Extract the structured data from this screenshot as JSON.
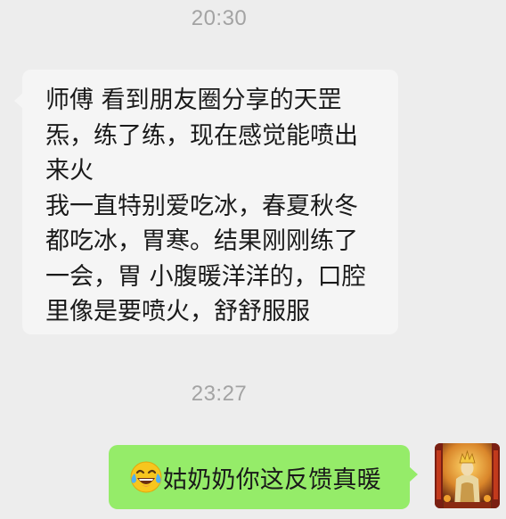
{
  "chat": {
    "timestamp_1": "20:30",
    "incoming_message": {
      "lines": [
        "师傅 看到朋友圈分享的天罡",
        "炁，练了练，现在感觉能喷出",
        "来火",
        "我一直特别爱吃冰，春夏秋冬",
        "都吃冰，胃寒。结果刚刚练了",
        "一会，胃 小腹暖洋洋的，口腔",
        "里像是要喷火，舒舒服服"
      ]
    },
    "timestamp_2": "23:27",
    "outgoing_message": {
      "emoji": "tears-of-joy-emoji",
      "text": "姑奶奶你这反馈真暖"
    },
    "avatar": {
      "icon": "deity-statue-avatar"
    }
  },
  "colors": {
    "background": "#ededed",
    "incoming_bubble": "#f5f5f5",
    "outgoing_bubble": "#95ec69",
    "timestamp": "#a3a3a3"
  }
}
